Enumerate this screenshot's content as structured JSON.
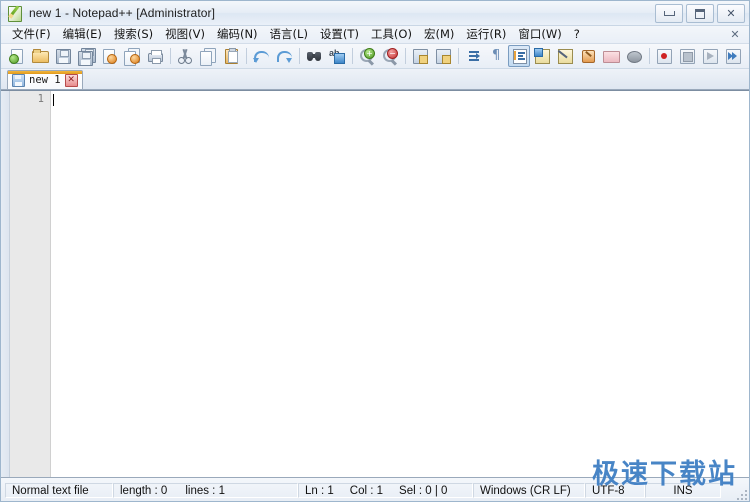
{
  "window": {
    "title": "new 1 - Notepad++ [Administrator]",
    "icon": "notepadpp-icon",
    "controls": {
      "minimize": "minimize-button",
      "maximize": "maximize-button",
      "close": "close-button",
      "close_glyph": "✕"
    }
  },
  "menubar": {
    "items": [
      {
        "label": "文件(F)",
        "name": "menu-file"
      },
      {
        "label": "编辑(E)",
        "name": "menu-edit"
      },
      {
        "label": "搜索(S)",
        "name": "menu-search"
      },
      {
        "label": "视图(V)",
        "name": "menu-view"
      },
      {
        "label": "编码(N)",
        "name": "menu-encoding"
      },
      {
        "label": "语言(L)",
        "name": "menu-language"
      },
      {
        "label": "设置(T)",
        "name": "menu-settings"
      },
      {
        "label": "工具(O)",
        "name": "menu-tools"
      },
      {
        "label": "宏(M)",
        "name": "menu-macro"
      },
      {
        "label": "运行(R)",
        "name": "menu-run"
      },
      {
        "label": "窗口(W)",
        "name": "menu-window"
      },
      {
        "label": "?",
        "name": "menu-help"
      }
    ],
    "document_close_glyph": "✕"
  },
  "toolbar": {
    "buttons": [
      {
        "name": "new-file-icon",
        "tooltip": "New"
      },
      {
        "name": "open-file-icon",
        "tooltip": "Open"
      },
      {
        "name": "save-icon",
        "tooltip": "Save"
      },
      {
        "name": "save-all-icon",
        "tooltip": "Save All"
      },
      {
        "name": "close-file-icon",
        "tooltip": "Close"
      },
      {
        "name": "close-all-files-icon",
        "tooltip": "Close All"
      },
      {
        "name": "print-icon",
        "tooltip": "Print"
      },
      {
        "name": "cut-icon",
        "tooltip": "Cut"
      },
      {
        "name": "copy-icon",
        "tooltip": "Copy"
      },
      {
        "name": "paste-icon",
        "tooltip": "Paste"
      },
      {
        "name": "undo-icon",
        "tooltip": "Undo"
      },
      {
        "name": "redo-icon",
        "tooltip": "Redo"
      },
      {
        "name": "find-icon",
        "tooltip": "Find"
      },
      {
        "name": "replace-icon",
        "tooltip": "Replace"
      },
      {
        "name": "zoom-in-icon",
        "tooltip": "Zoom In"
      },
      {
        "name": "zoom-out-icon",
        "tooltip": "Zoom Out"
      },
      {
        "name": "sync-vertical-scroll-icon",
        "tooltip": "Sync Vertical Scrolling"
      },
      {
        "name": "sync-horizontal-scroll-icon",
        "tooltip": "Sync Horizontal Scrolling"
      },
      {
        "name": "word-wrap-toggle-icon",
        "tooltip": "Word Wrap"
      },
      {
        "name": "show-all-chars-icon",
        "tooltip": "Show All Characters"
      },
      {
        "name": "indent-guide-icon",
        "tooltip": "Indent Guideline",
        "pressed": true
      },
      {
        "name": "ui-language-icon",
        "tooltip": "UI Language"
      },
      {
        "name": "document-map-icon",
        "tooltip": "Document Map"
      },
      {
        "name": "function-list-icon",
        "tooltip": "Function List"
      },
      {
        "name": "folder-workspace-icon",
        "tooltip": "Folder as Workspace"
      },
      {
        "name": "monitoring-icon",
        "tooltip": "Monitoring"
      },
      {
        "name": "macro-record-icon",
        "tooltip": "Start Recording"
      },
      {
        "name": "macro-stop-icon",
        "tooltip": "Stop Recording"
      },
      {
        "name": "macro-play-icon",
        "tooltip": "Playback"
      },
      {
        "name": "macro-run-multiple-icon",
        "tooltip": "Run a Macro Multiple Times"
      },
      {
        "name": "macro-save-icon",
        "tooltip": "Save Current Recorded Macro"
      }
    ]
  },
  "tabs": {
    "active_index": 0,
    "items": [
      {
        "label": "new 1",
        "name": "tab-new-1",
        "close_glyph": "✕",
        "saved": true
      }
    ]
  },
  "editor": {
    "line_numbers": [
      "1"
    ],
    "content": ""
  },
  "statusbar": {
    "doc_type": "Normal text file",
    "length_label": "length : 0",
    "lines_label": "lines : 1",
    "ln": "Ln : 1",
    "col": "Col : 1",
    "sel": "Sel : 0 | 0",
    "eol": "Windows (CR LF)",
    "encoding": "UTF-8",
    "insert_mode": "INS"
  },
  "watermark": {
    "text": "极速下载站",
    "color": "#3f7fc4"
  }
}
